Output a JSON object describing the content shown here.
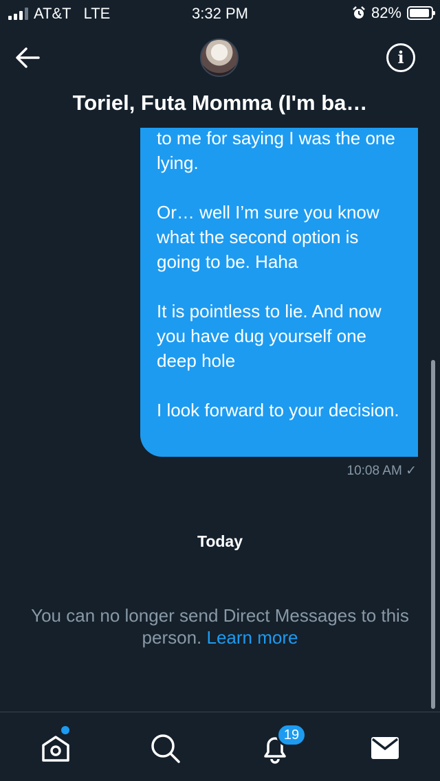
{
  "status_bar": {
    "carrier": "AT&T",
    "network": "LTE",
    "time": "3:32 PM",
    "battery": "82%",
    "battery_level": 0.82,
    "alarm_icon": "alarm-clock-icon"
  },
  "header": {
    "title": "Toriel, Futa Momma (I'm ba…",
    "back_icon": "arrow-left-icon",
    "info_icon": "info-circle-icon"
  },
  "message": {
    "paragraphs": [
      "to me for saying I was the one lying.",
      "Or… well I’m sure you know what the second option is going to be. Haha",
      "It is pointless to lie. And now you have dug yourself one deep hole",
      "I look forward to your decision."
    ],
    "time": "10:08 AM ✓",
    "color": "#1d9bf0"
  },
  "divider_label": "Today",
  "notice": {
    "text": "You can no longer send Direct Messages to this person.",
    "link": "Learn more"
  },
  "tab_bar": {
    "tabs": [
      {
        "name": "home",
        "icon": "home-icon"
      },
      {
        "name": "search",
        "icon": "search-icon"
      },
      {
        "name": "notifications",
        "icon": "bell-icon"
      },
      {
        "name": "messages",
        "icon": "envelope-icon"
      }
    ],
    "notifications_badge": "19"
  },
  "colors": {
    "background": "#15202b",
    "accent": "#1d9bf0",
    "secondary_text": "#8899a6"
  }
}
